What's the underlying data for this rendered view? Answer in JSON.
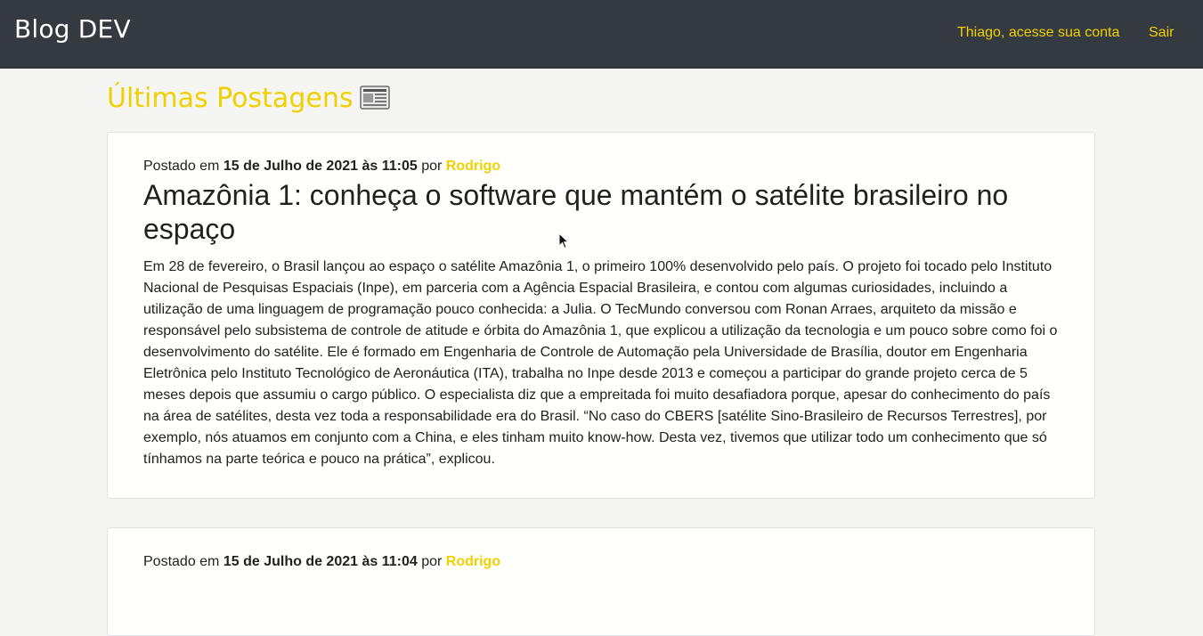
{
  "navbar": {
    "brand": "Blog DEV",
    "account_link": "Thiago, acesse sua conta",
    "logout_link": "Sair"
  },
  "page": {
    "title": "Últimas Postagens",
    "title_icon": "newspaper-icon"
  },
  "posts": [
    {
      "meta_prefix": "Postado em",
      "date": "15 de Julho de 2021 às 11:05",
      "meta_by": "por",
      "author": "Rodrigo",
      "title": "Amazônia 1: conheça o software que mantém o satélite brasileiro no espaço",
      "body": "Em 28 de fevereiro, o Brasil lançou ao espaço o satélite Amazônia 1, o primeiro 100% desenvolvido pelo país. O projeto foi tocado pelo Instituto Nacional de Pesquisas Espaciais (Inpe), em parceria com a Agência Espacial Brasileira, e contou com algumas curiosidades, incluindo a utilização de uma linguagem de programação pouco conhecida: a Julia. O TecMundo conversou com Ronan Arraes, arquiteto da missão e responsável pelo subsistema de controle de atitude e órbita do Amazônia 1, que explicou a utilização da tecnologia e um pouco sobre como foi o desenvolvimento do satélite. Ele é formado em Engenharia de Controle de Automação pela Universidade de Brasília, doutor em Engenharia Eletrônica pelo Instituto Tecnológico de Aeronáutica (ITA), trabalha no Inpe desde 2013 e começou a participar do grande projeto cerca de 5 meses depois que assumiu o cargo público. O especialista diz que a empreitada foi muito desafiadora porque, apesar do conhecimento do país na área de satélites, desta vez toda a responsabilidade era do Brasil. “No caso do CBERS [satélite Sino-Brasileiro de Recursos Terrestres], por exemplo, nós atuamos em conjunto com a China, e eles tinham muito know-how. Desta vez, tivemos que utilizar todo um conhecimento que só tínhamos na parte teórica e pouco na prática”, explicou."
    },
    {
      "meta_prefix": "Postado em",
      "date": "15 de Julho de 2021 às 11:04",
      "meta_by": "por",
      "author": "Rodrigo"
    }
  ],
  "colors": {
    "navbar_bg": "#343a40",
    "accent": "#f0d000",
    "page_bg": "#f5f6f4"
  }
}
